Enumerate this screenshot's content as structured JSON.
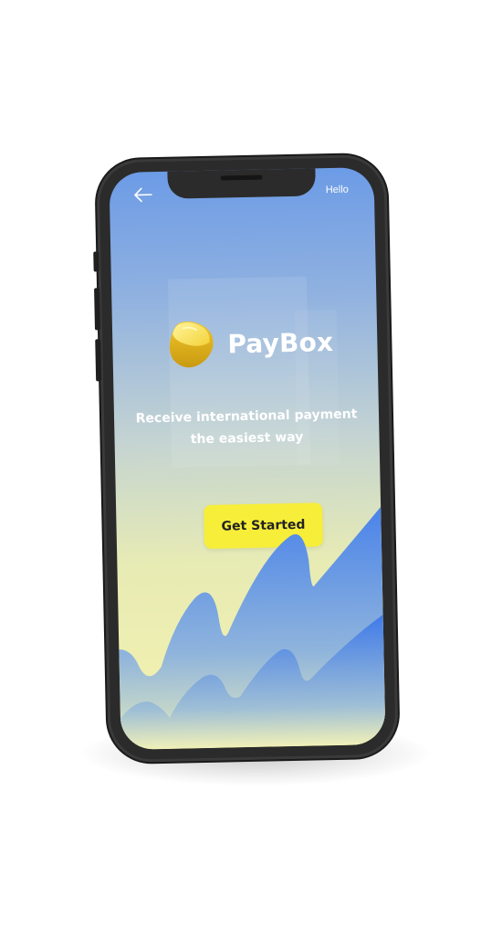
{
  "header": {
    "back_icon": "arrow-left-icon",
    "right_label": "Hello"
  },
  "brand": {
    "name": "PayBox",
    "logo_icon": "yellow-cube-logo"
  },
  "hero": {
    "tagline": "Receive international payment the easiest way"
  },
  "cta": {
    "label": "Get Started"
  },
  "colors": {
    "gradient_top": "#6c9be6",
    "gradient_bottom": "#f5f2ad",
    "cta_bg": "#f7ee3a",
    "wave_blue": "#4f86ea"
  }
}
